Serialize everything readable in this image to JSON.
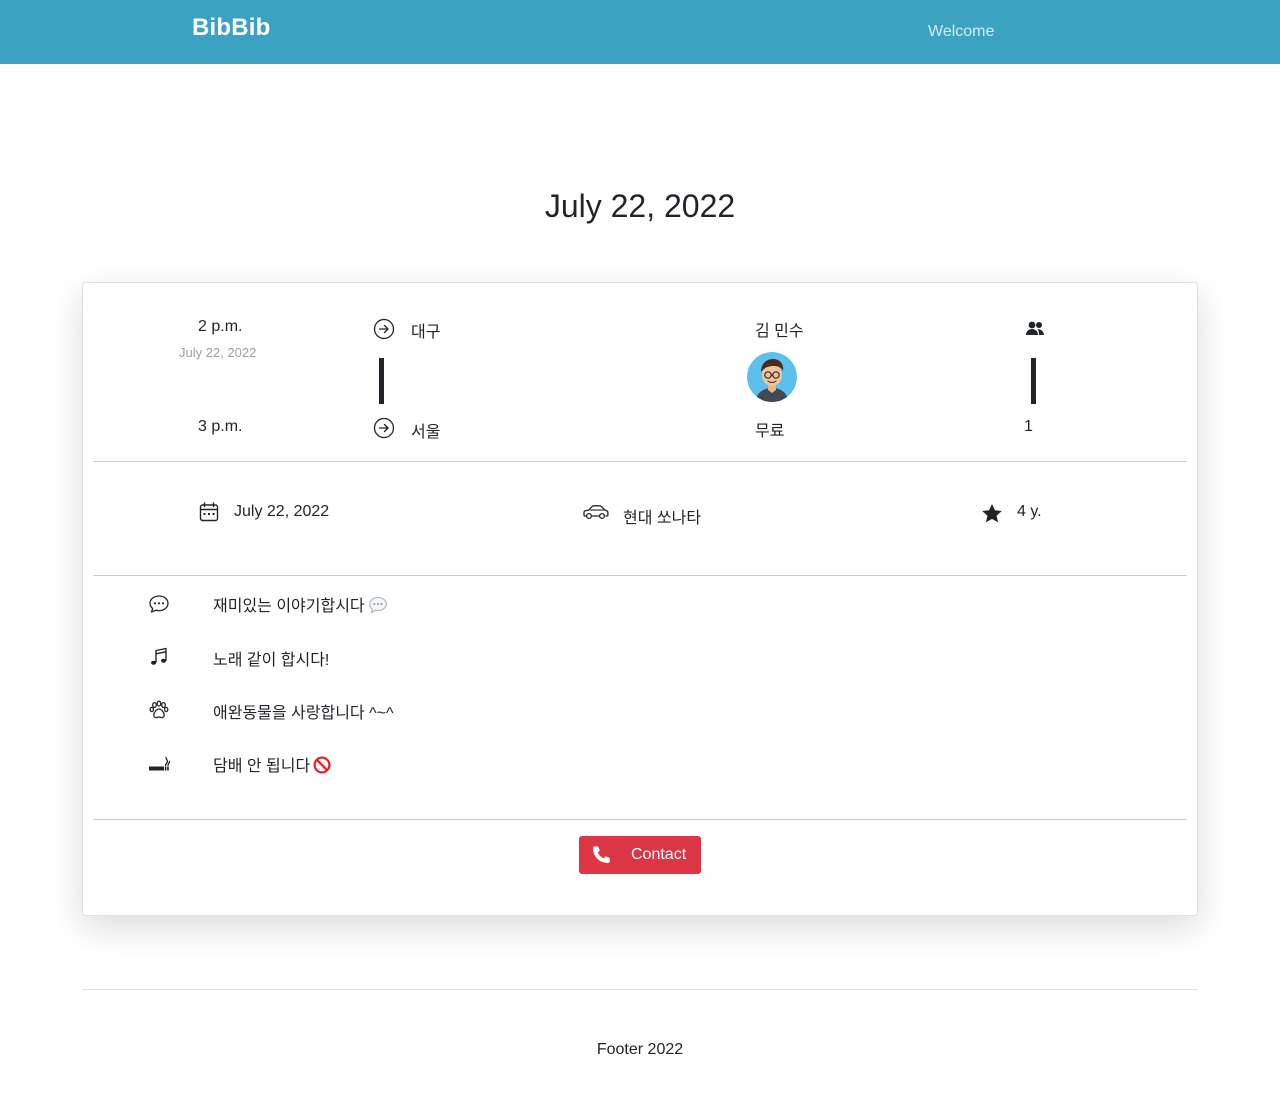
{
  "navbar": {
    "brand": "BibBib",
    "welcome_link": "Welcome"
  },
  "page_title": "July 22, 2022",
  "trip": {
    "departure_time": "2 p.m.",
    "departure_date": "July 22, 2022",
    "arrival_time": "3 p.m.",
    "origin": "대구",
    "destination": "서울",
    "driver_name": "김 민수",
    "price": "무료",
    "seats": "1"
  },
  "details": {
    "date": "July 22, 2022",
    "car": "현대 쏘나타",
    "experience": "4 y."
  },
  "preferences": [
    {
      "icon": "chat-icon",
      "text": "재미있는 이야기합시다"
    },
    {
      "icon": "music-note-icon",
      "text": "노래 같이 합시다!"
    },
    {
      "icon": "paw-icon",
      "text": "애완동물을 사랑합니다 ^~^"
    },
    {
      "icon": "smoking-icon",
      "text": "담배 안 됩니다"
    }
  ],
  "contact_button": "Contact",
  "footer": "Footer 2022",
  "colors": {
    "navbar": "#3ba3c1",
    "contact_button": "#dc3545"
  }
}
